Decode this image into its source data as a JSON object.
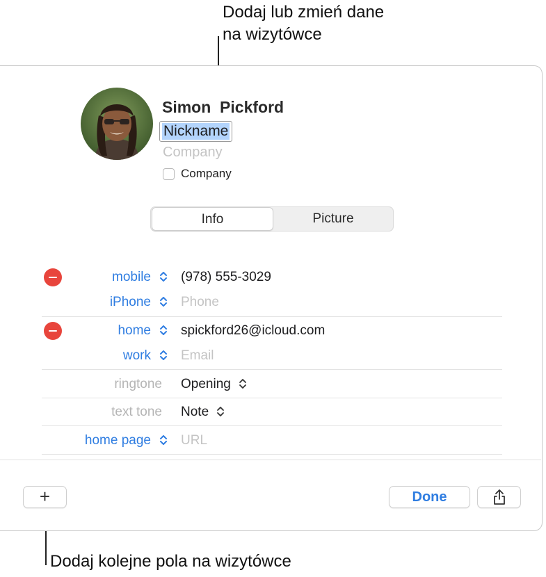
{
  "callouts": {
    "top": "Dodaj lub zmień dane\nna wizytówce",
    "bottom": "Dodaj kolejne pola na wizytówce"
  },
  "card": {
    "name": "Simon  Pickford",
    "nickname": "Nickname",
    "company_placeholder": "Company",
    "company_checkbox_label": "Company",
    "company_checked": false
  },
  "tabs": [
    {
      "label": "Info",
      "selected": true
    },
    {
      "label": "Picture",
      "selected": false
    }
  ],
  "fields": {
    "phone_1": {
      "label": "mobile",
      "value": "(978) 555-3029"
    },
    "phone_2": {
      "label": "iPhone",
      "placeholder": "Phone"
    },
    "email_1": {
      "label": "home",
      "value": "spickford26@icloud.com"
    },
    "email_2": {
      "label": "work",
      "placeholder": "Email"
    },
    "ringtone": {
      "label": "ringtone",
      "value": "Opening"
    },
    "text_tone": {
      "label": "text tone",
      "value": "Note"
    },
    "home_page": {
      "label": "home page",
      "placeholder": "URL"
    }
  },
  "footer": {
    "add_label": "+",
    "done_label": "Done",
    "share_icon": "share-icon"
  },
  "colors": {
    "accent": "#2f7de1",
    "delete": "#e8453c",
    "selection": "#b3d4fc"
  }
}
